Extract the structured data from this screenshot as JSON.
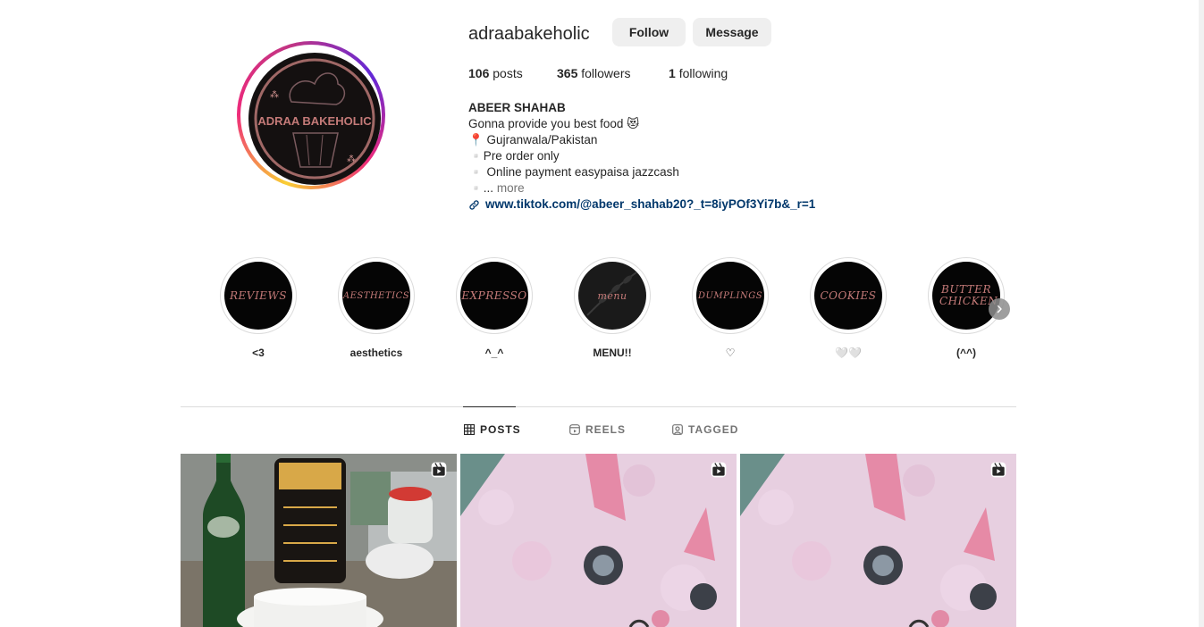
{
  "profile": {
    "username": "adraabakeholic",
    "follow_label": "Follow",
    "message_label": "Message",
    "avatar_text": "ADRAA BAKEHOLIC",
    "stats": {
      "posts_count": "106",
      "posts_label": "posts",
      "followers_count": "365",
      "followers_label": "followers",
      "following_count": "1",
      "following_label": "following"
    },
    "bio": {
      "name": "ABEER SHAHAB",
      "line1": "Gonna provide you best food 😻",
      "line2": "📍 Gujranwala/Pakistan",
      "line3": "▫️Pre order only",
      "line4": "▫️ Online payment easypaisa jazzcash",
      "line5_prefix": "▫️...",
      "more_label": "more",
      "link": "www.tiktok.com/@abeer_shahab20?_t=8iyPOf3Yi7b&_r=1"
    }
  },
  "highlights": [
    {
      "cover_text": "REVIEWS",
      "label": "<3"
    },
    {
      "cover_text": "AESTHETICS",
      "label": "aesthetics"
    },
    {
      "cover_text": "EXPRESSO",
      "label": "^_^"
    },
    {
      "cover_text": "menu",
      "label": "MENU!!"
    },
    {
      "cover_text": "DUMPLINGS",
      "label": "♡"
    },
    {
      "cover_text": "COOKIES",
      "label": "🤍🤍"
    },
    {
      "cover_text": "BUTTER CHICKEN",
      "label": "(^^)"
    }
  ],
  "tabs": [
    {
      "label": "POSTS",
      "icon": "grid-icon",
      "active": true
    },
    {
      "label": "REELS",
      "icon": "reels-icon",
      "active": false
    },
    {
      "label": "TAGGED",
      "icon": "tagged-icon",
      "active": false
    }
  ],
  "colors": {
    "link": "#00376b",
    "button_bg": "#efefef",
    "highlight_text": "#c47a78"
  }
}
